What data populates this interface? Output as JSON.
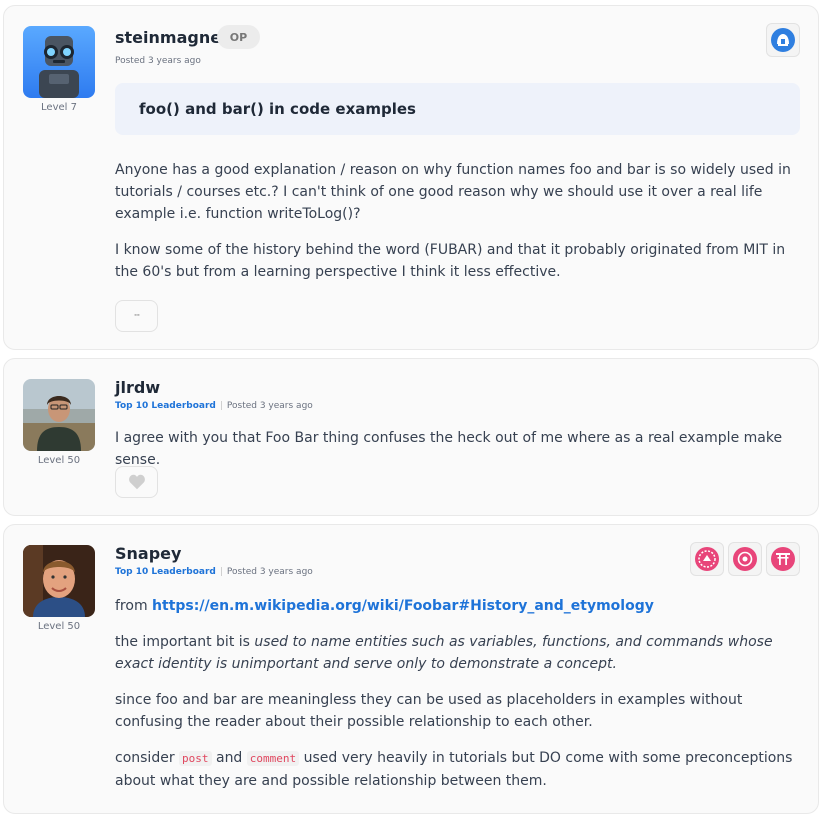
{
  "posts": [
    {
      "username": "steinmagne",
      "op_label": "OP",
      "posted": "Posted 3 years ago",
      "level": "Level 7",
      "title": "foo() and bar() in code examples",
      "paragraphs": [
        "Anyone has a good explanation / reason on why function names foo and bar is so widely used in tutorials / courses etc.? I can't think of one good reason why we should use it over a real life example i.e. function writeToLog()?",
        "I know some of the history behind the word (FUBAR) and that it probably originated from MIT in the 60's but from a learning perspective I think it less effective."
      ],
      "more_label": "···",
      "badge_icon": "helmet-badge-icon"
    },
    {
      "username": "jlrdw",
      "leaderboard": "Top 10 Leaderboard",
      "separator": "|",
      "posted": "Posted 3 years ago",
      "level": "Level 50",
      "text": "I agree with you that Foo Bar thing confuses the heck out of me where as a real example make sense.",
      "like_icon": "heart-icon"
    },
    {
      "username": "Snapey",
      "leaderboard": "Top 10 Leaderboard",
      "separator": "|",
      "posted": "Posted 3 years ago",
      "level": "Level 50",
      "from_prefix": "from",
      "link": "https://en.m.wikipedia.org/wiki/Foobar#History_and_etymology",
      "p2_prefix": "the important bit is",
      "p2_quote": "used to name entities such as variables, functions, and commands whose exact identity is unimportant and serve only to demonstrate a concept.",
      "p3": "since foo and bar are meaningless they can be used as placeholders in examples without confusing the reader about their possible relationship to each other.",
      "p4_prefix": "consider",
      "p4_code1": "post",
      "p4_and": "and",
      "p4_code2": "comment",
      "p4_suffix": "used very heavily in tutorials but DO come with some preconceptions about what they are and possible relationship between them.",
      "badges": [
        "laravel-badge-icon",
        "flower-badge-icon",
        "torii-badge-icon"
      ]
    }
  ],
  "colors": {
    "link": "#1e73d8",
    "badge_pink": "#e8457a",
    "badge_blue": "#2f7fe0",
    "title_bg": "#eef2fa"
  }
}
